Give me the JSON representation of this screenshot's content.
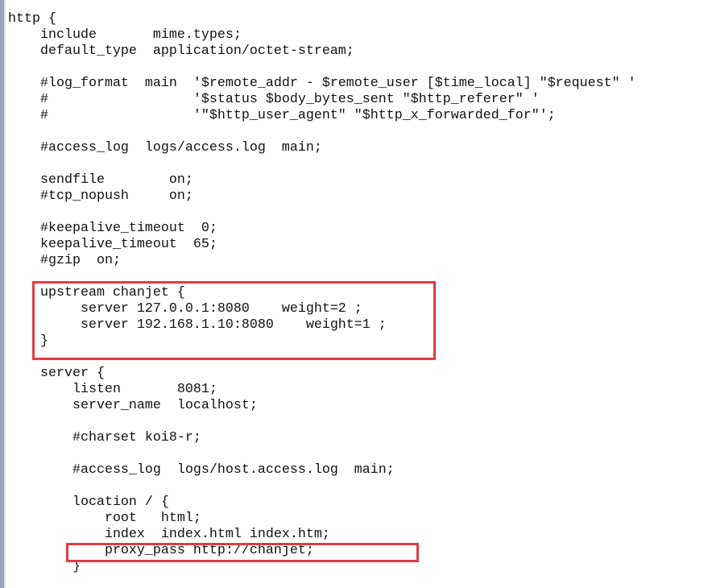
{
  "editor": {
    "lines": [
      "http {",
      "    include       mime.types;",
      "    default_type  application/octet-stream;",
      "",
      "    #log_format  main  '$remote_addr - $remote_user [$time_local] \"$request\" '",
      "    #                  '$status $body_bytes_sent \"$http_referer\" '",
      "    #                  '\"$http_user_agent\" \"$http_x_forwarded_for\"';",
      "",
      "    #access_log  logs/access.log  main;",
      "",
      "    sendfile        on;",
      "    #tcp_nopush     on;",
      "",
      "    #keepalive_timeout  0;",
      "    keepalive_timeout  65;",
      "    #gzip  on;",
      "",
      "    upstream chanjet {",
      "         server 127.0.0.1:8080    weight=2 ;",
      "         server 192.168.1.10:8080    weight=1 ;",
      "    }",
      "",
      "    server {",
      "        listen       8081;",
      "        server_name  localhost;",
      "",
      "        #charset koi8-r;",
      "",
      "        #access_log  logs/host.access.log  main;",
      "",
      "        location / {",
      "            root   html;",
      "            index  index.html index.htm;",
      "            proxy_pass http://chanjet;",
      "        }"
    ],
    "highlight_color": "#e23b40"
  }
}
